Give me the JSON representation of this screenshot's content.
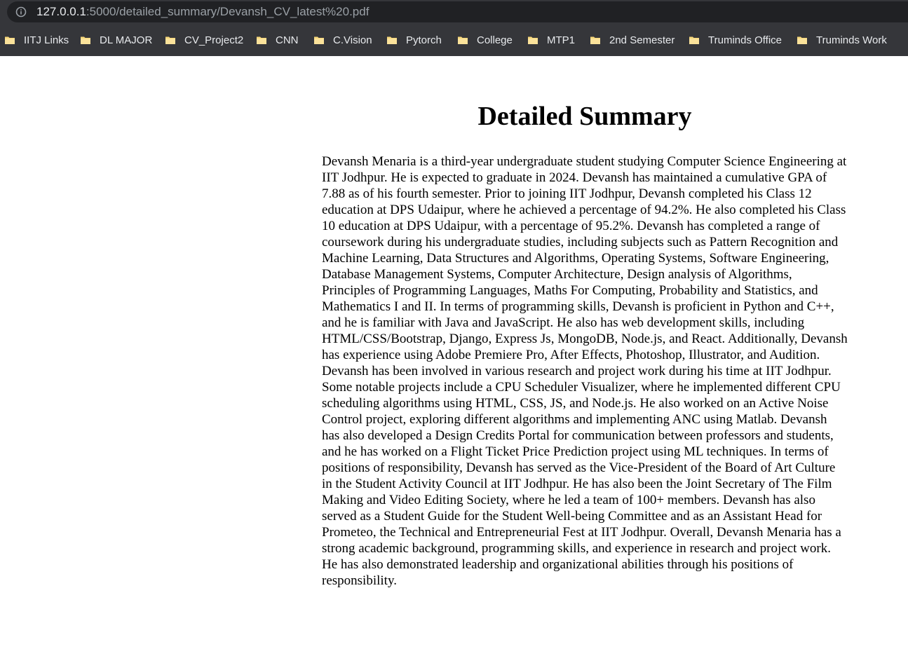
{
  "browser": {
    "url_host": "127.0.0.1",
    "url_path": ":5000/detailed_summary/Devansh_CV_latest%20.pdf",
    "bookmarks": [
      {
        "label": "IITJ Links"
      },
      {
        "label": "DL MAJOR"
      },
      {
        "label": "CV_Project2"
      },
      {
        "label": "CNN"
      },
      {
        "label": "C.Vision"
      },
      {
        "label": "Pytorch"
      },
      {
        "label": "College"
      },
      {
        "label": "MTP1"
      },
      {
        "label": "2nd Semester"
      },
      {
        "label": "Truminds Office"
      },
      {
        "label": "Truminds Work"
      }
    ],
    "icons": {
      "info": "info-icon",
      "bookmark": "folder-icon"
    },
    "colors": {
      "toolbar_bg": "#35363a",
      "address_bg": "#202124",
      "folder_fill": "#f6d77a"
    }
  },
  "page": {
    "title": "Detailed Summary",
    "summary": "Devansh Menaria is a third-year undergraduate student studying Computer Science Engineering at IIT Jodhpur. He is expected to graduate in 2024. Devansh has maintained a cumulative GPA of 7.88 as of his fourth semester. Prior to joining IIT Jodhpur, Devansh completed his Class 12 education at DPS Udaipur, where he achieved a percentage of 94.2%. He also completed his Class 10 education at DPS Udaipur, with a percentage of 95.2%. Devansh has completed a range of coursework during his undergraduate studies, including subjects such as Pattern Recognition and Machine Learning, Data Structures and Algorithms, Operating Systems, Software Engineering, Database Management Systems, Computer Architecture, Design analysis of Algorithms, Principles of Programming Languages, Maths For Computing, Probability and Statistics, and Mathematics I and II. In terms of programming skills, Devansh is proficient in Python and C++, and he is familiar with Java and JavaScript. He also has web development skills, including HTML/CSS/Bootstrap, Django, Express Js, MongoDB, Node.js, and React. Additionally, Devansh has experience using Adobe Premiere Pro, After Effects, Photoshop, Illustrator, and Audition. Devansh has been involved in various research and project work during his time at IIT Jodhpur. Some notable projects include a CPU Scheduler Visualizer, where he implemented different CPU scheduling algorithms using HTML, CSS, JS, and Node.js. He also worked on an Active Noise Control project, exploring different algorithms and implementing ANC using Matlab. Devansh has also developed a Design Credits Portal for communication between professors and students, and he has worked on a Flight Ticket Price Prediction project using ML techniques. In terms of positions of responsibility, Devansh has served as the Vice-President of the Board of Art Culture in the Student Activity Council at IIT Jodhpur. He has also been the Joint Secretary of The Film Making and Video Editing Society, where he led a team of 100+ members. Devansh has also served as a Student Guide for the Student Well-being Committee and as an Assistant Head for Prometeo, the Technical and Entrepreneurial Fest at IIT Jodhpur. Overall, Devansh Menaria has a strong academic background, programming skills, and experience in research and project work. He has also demonstrated leadership and organizational abilities through his positions of responsibility."
  }
}
